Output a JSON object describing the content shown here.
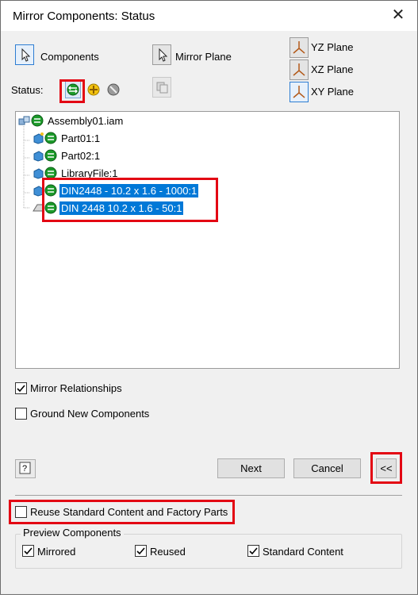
{
  "window": {
    "title": "Mirror Components: Status"
  },
  "selectors": {
    "components_label": "Components",
    "mirror_plane_label": "Mirror Plane"
  },
  "planes": [
    {
      "label": "YZ Plane"
    },
    {
      "label": "XZ Plane"
    },
    {
      "label": "XY Plane"
    }
  ],
  "status": {
    "label": "Status:",
    "options": [
      "mirror",
      "reuse",
      "exclude"
    ],
    "selected": "mirror"
  },
  "tree": {
    "root": "Assembly01.iam",
    "items": [
      {
        "label": "Part01:1",
        "selected": false
      },
      {
        "label": "Part02:1",
        "selected": false
      },
      {
        "label": "LibraryFile:1",
        "selected": false
      },
      {
        "label": "DIN2448 - 10.2 x 1.6 - 1000:1",
        "selected": true
      },
      {
        "label": "DIN 2448 10.2 x 1.6 - 50:1",
        "selected": true
      }
    ]
  },
  "options": {
    "mirror_relationships": {
      "label": "Mirror Relationships",
      "checked": true
    },
    "ground_new": {
      "label": "Ground New Components",
      "checked": false
    }
  },
  "buttons": {
    "next": "Next",
    "cancel": "Cancel",
    "collapse": "<<"
  },
  "reuse_standard": {
    "label": "Reuse Standard Content and Factory Parts",
    "checked": false
  },
  "preview": {
    "title": "Preview Components",
    "mirrored": {
      "label": "Mirrored",
      "checked": true
    },
    "reused": {
      "label": "Reused",
      "checked": true
    },
    "standard": {
      "label": "Standard Content",
      "checked": true
    }
  },
  "colors": {
    "highlight": "#0078d7",
    "annotation": "#e30613",
    "status_green": "#1c9a2a",
    "status_yellow": "#f2c20f"
  }
}
